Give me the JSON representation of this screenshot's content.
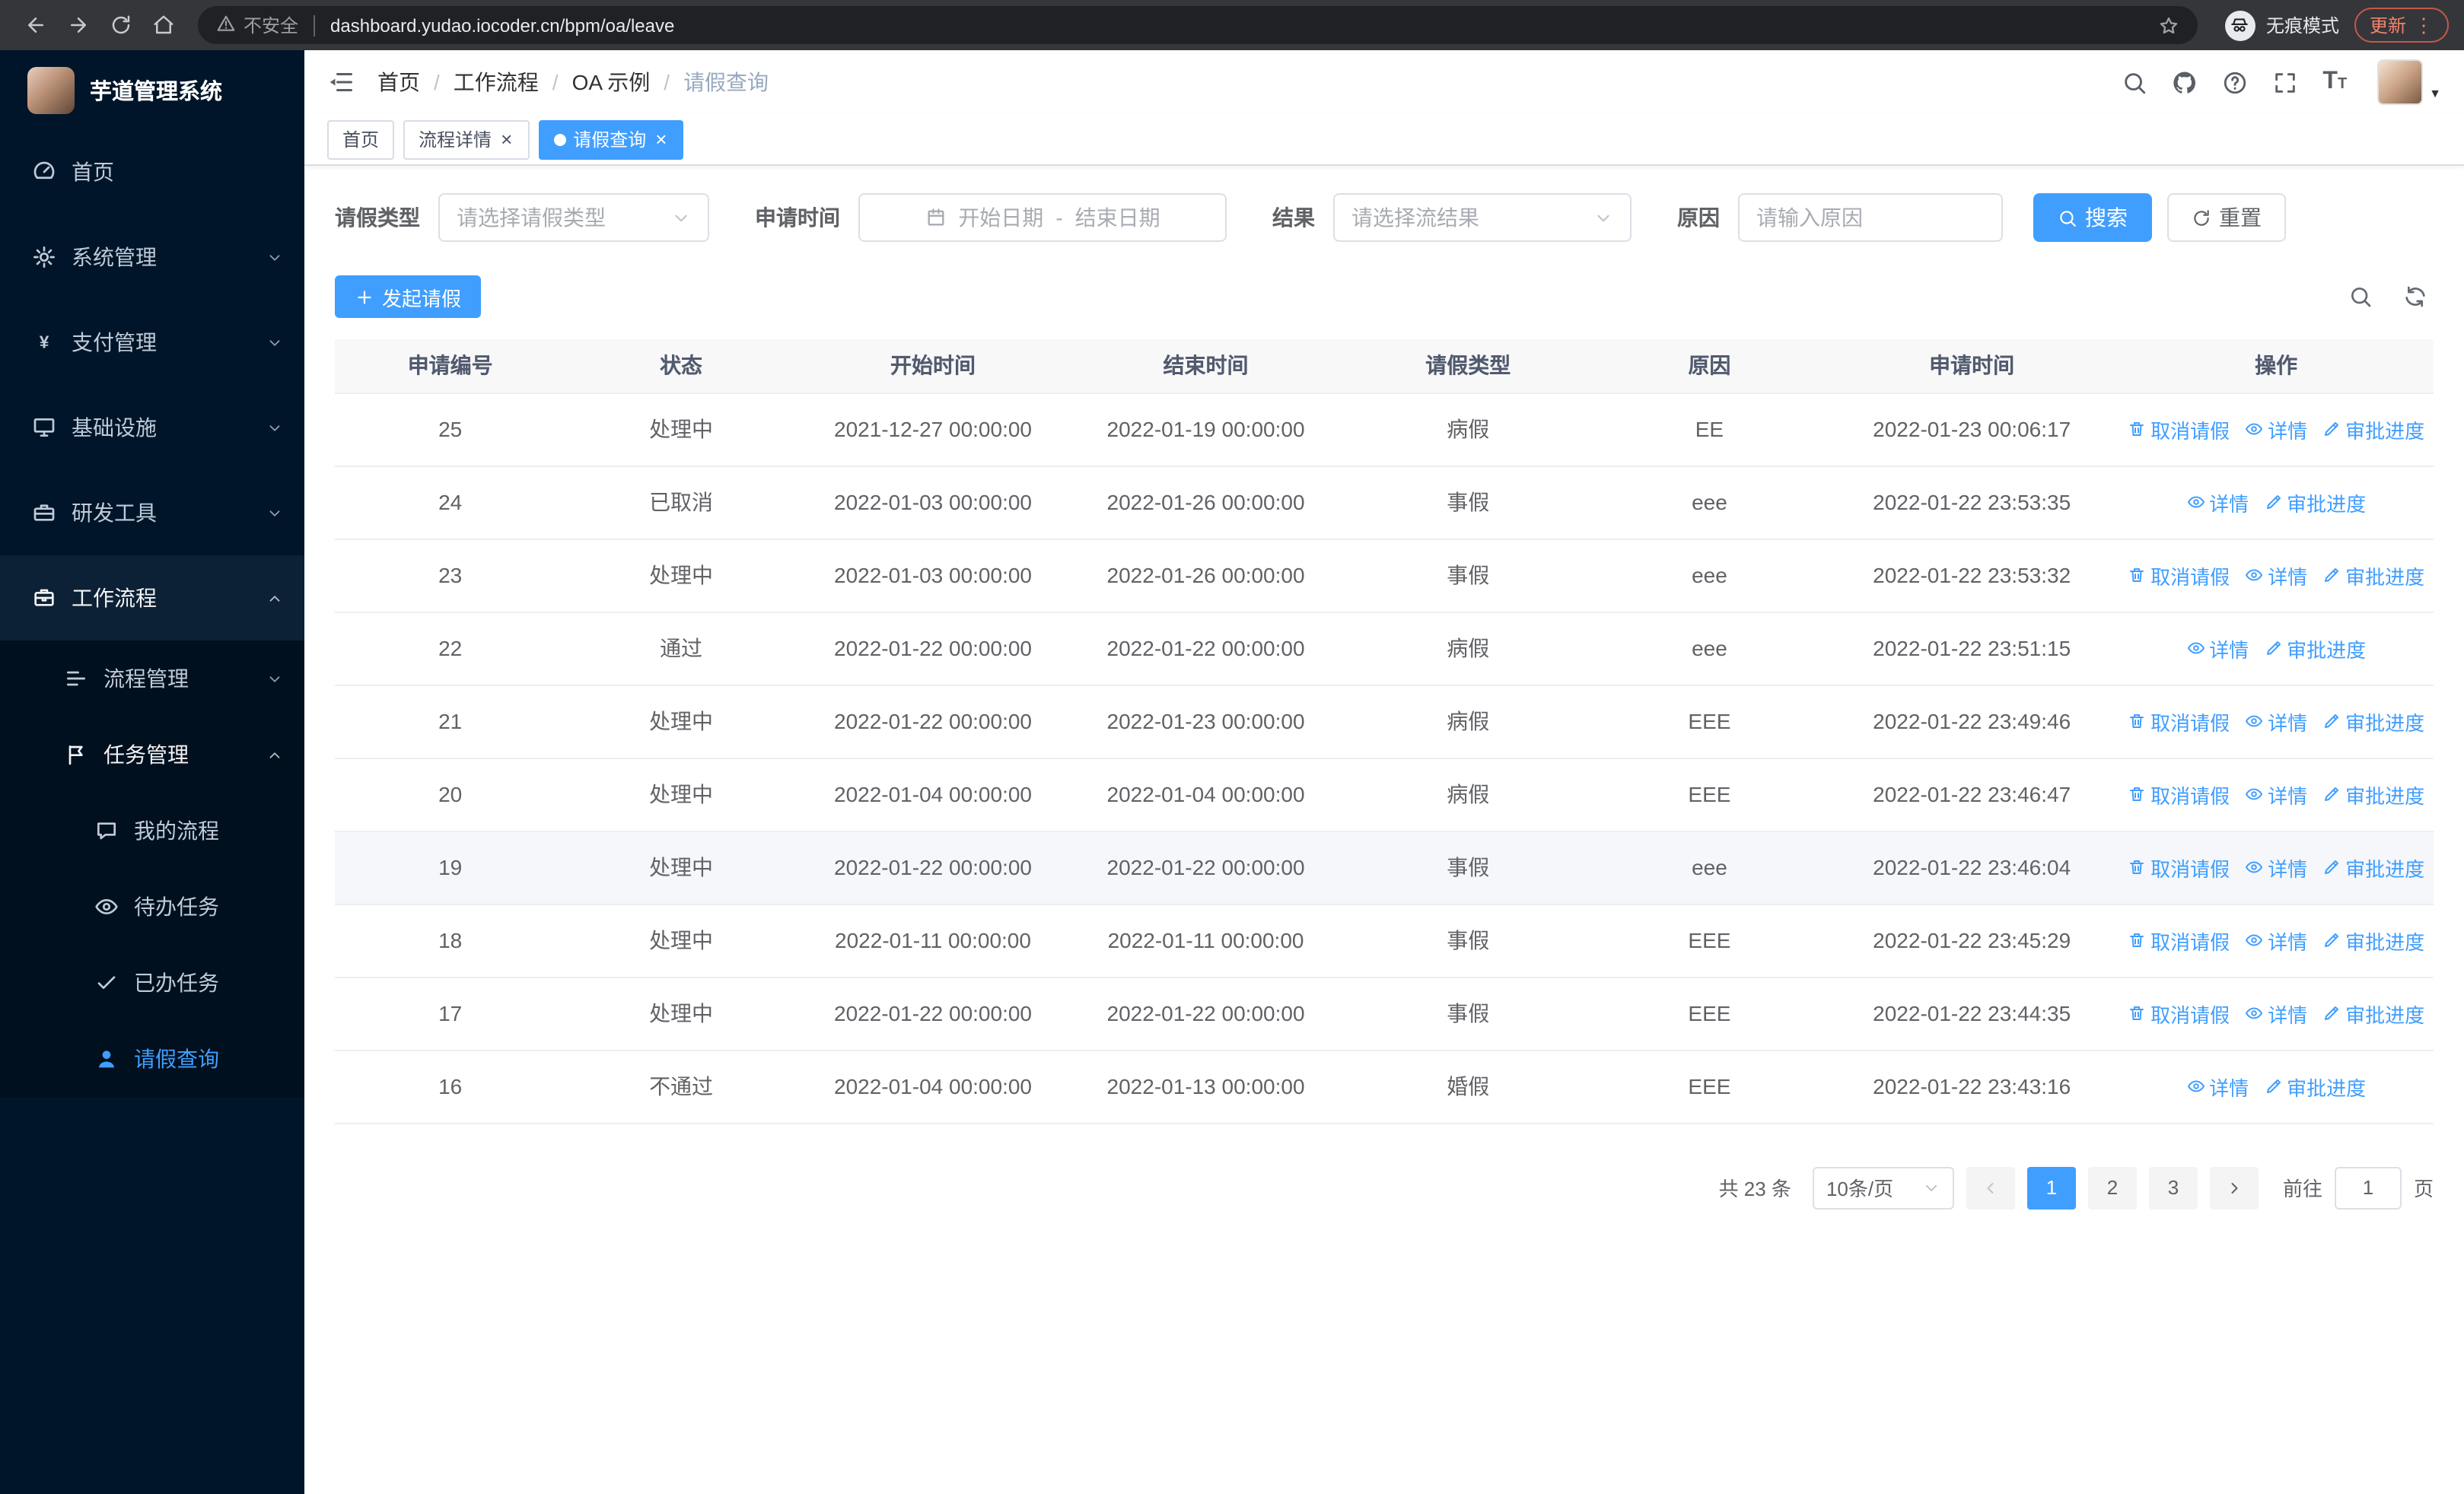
{
  "accent_color": "#409eff",
  "browser": {
    "security_warning": "不安全",
    "url": "dashboard.yudao.iocoder.cn/bpm/oa/leave",
    "incognito_label": "无痕模式",
    "update_label": "更新"
  },
  "sidebar": {
    "logo_title": "芋道管理系统",
    "menu": [
      {
        "label": "首页",
        "icon": "home-icon",
        "level": 1
      },
      {
        "label": "系统管理",
        "icon": "gear-icon",
        "level": 1,
        "arrow": "down"
      },
      {
        "label": "支付管理",
        "icon": "payment-icon",
        "level": 1,
        "arrow": "down"
      },
      {
        "label": "基础设施",
        "icon": "infrastructure-icon",
        "level": 1,
        "arrow": "down"
      },
      {
        "label": "研发工具",
        "icon": "devtools-icon",
        "level": 1,
        "arrow": "down"
      },
      {
        "label": "工作流程",
        "icon": "workflow-icon",
        "level": 1,
        "arrow": "up",
        "open": true
      },
      {
        "label": "流程管理",
        "icon": "process-icon",
        "level": 2,
        "arrow": "down"
      },
      {
        "label": "任务管理",
        "icon": "task-icon",
        "level": 2,
        "arrow": "up",
        "open": true
      },
      {
        "label": "我的流程",
        "icon": "chat-icon",
        "level": 3
      },
      {
        "label": "待办任务",
        "icon": "eye-icon",
        "level": 3
      },
      {
        "label": "已办任务",
        "icon": "check-icon",
        "level": 3
      },
      {
        "label": "请假查询",
        "icon": "user-icon",
        "level": 3,
        "active": true
      }
    ]
  },
  "navbar": {
    "breadcrumb": [
      "首页",
      "工作流程",
      "OA 示例",
      "请假查询"
    ]
  },
  "tags": [
    {
      "label": "首页",
      "closable": false,
      "active": false
    },
    {
      "label": "流程详情",
      "closable": true,
      "active": false
    },
    {
      "label": "请假查询",
      "closable": true,
      "active": true
    }
  ],
  "filters": {
    "leave_type": {
      "label": "请假类型",
      "placeholder": "请选择请假类型"
    },
    "apply_time": {
      "label": "申请时间",
      "start_placeholder": "开始日期",
      "separator": "-",
      "end_placeholder": "结束日期"
    },
    "result": {
      "label": "结果",
      "placeholder": "请选择流结果"
    },
    "reason": {
      "label": "原因",
      "placeholder": "请输入原因"
    },
    "search_button": "搜索",
    "reset_button": "重置"
  },
  "toolbar": {
    "create_button": "发起请假"
  },
  "table": {
    "headers": [
      "申请编号",
      "状态",
      "开始时间",
      "结束时间",
      "请假类型",
      "原因",
      "申请时间",
      "操作"
    ],
    "action_labels": {
      "cancel": "取消请假",
      "detail": "详情",
      "progress": "审批进度"
    },
    "rows": [
      {
        "id": "25",
        "status": "处理中",
        "start_time": "2021-12-27 00:00:00",
        "end_time": "2022-01-19 00:00:00",
        "leave_type": "病假",
        "reason": "EE",
        "apply_time": "2022-01-23 00:06:17",
        "actions": [
          "cancel",
          "detail",
          "progress"
        ]
      },
      {
        "id": "24",
        "status": "已取消",
        "start_time": "2022-01-03 00:00:00",
        "end_time": "2022-01-26 00:00:00",
        "leave_type": "事假",
        "reason": "eee",
        "apply_time": "2022-01-22 23:53:35",
        "actions": [
          "detail",
          "progress"
        ]
      },
      {
        "id": "23",
        "status": "处理中",
        "start_time": "2022-01-03 00:00:00",
        "end_time": "2022-01-26 00:00:00",
        "leave_type": "事假",
        "reason": "eee",
        "apply_time": "2022-01-22 23:53:32",
        "actions": [
          "cancel",
          "detail",
          "progress"
        ]
      },
      {
        "id": "22",
        "status": "通过",
        "start_time": "2022-01-22 00:00:00",
        "end_time": "2022-01-22 00:00:00",
        "leave_type": "病假",
        "reason": "eee",
        "apply_time": "2022-01-22 23:51:15",
        "actions": [
          "detail",
          "progress"
        ]
      },
      {
        "id": "21",
        "status": "处理中",
        "start_time": "2022-01-22 00:00:00",
        "end_time": "2022-01-23 00:00:00",
        "leave_type": "病假",
        "reason": "EEE",
        "apply_time": "2022-01-22 23:49:46",
        "actions": [
          "cancel",
          "detail",
          "progress"
        ]
      },
      {
        "id": "20",
        "status": "处理中",
        "start_time": "2022-01-04 00:00:00",
        "end_time": "2022-01-04 00:00:00",
        "leave_type": "病假",
        "reason": "EEE",
        "apply_time": "2022-01-22 23:46:47",
        "actions": [
          "cancel",
          "detail",
          "progress"
        ]
      },
      {
        "id": "19",
        "status": "处理中",
        "start_time": "2022-01-22 00:00:00",
        "end_time": "2022-01-22 00:00:00",
        "leave_type": "事假",
        "reason": "eee",
        "apply_time": "2022-01-22 23:46:04",
        "actions": [
          "cancel",
          "detail",
          "progress"
        ],
        "highlighted": true
      },
      {
        "id": "18",
        "status": "处理中",
        "start_time": "2022-01-11 00:00:00",
        "end_time": "2022-01-11 00:00:00",
        "leave_type": "事假",
        "reason": "EEE",
        "apply_time": "2022-01-22 23:45:29",
        "actions": [
          "cancel",
          "detail",
          "progress"
        ]
      },
      {
        "id": "17",
        "status": "处理中",
        "start_time": "2022-01-22 00:00:00",
        "end_time": "2022-01-22 00:00:00",
        "leave_type": "事假",
        "reason": "EEE",
        "apply_time": "2022-01-22 23:44:35",
        "actions": [
          "cancel",
          "detail",
          "progress"
        ]
      },
      {
        "id": "16",
        "status": "不通过",
        "start_time": "2022-01-04 00:00:00",
        "end_time": "2022-01-13 00:00:00",
        "leave_type": "婚假",
        "reason": "EEE",
        "apply_time": "2022-01-22 23:43:16",
        "actions": [
          "detail",
          "progress"
        ]
      }
    ]
  },
  "pagination": {
    "total_text": "共 23 条",
    "page_size_label": "10条/页",
    "pages": [
      "1",
      "2",
      "3"
    ],
    "active_page": "1",
    "goto_label": "前往",
    "goto_value": "1",
    "page_unit": "页"
  }
}
